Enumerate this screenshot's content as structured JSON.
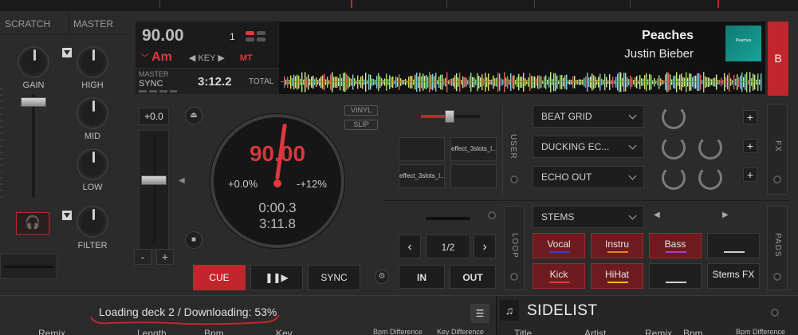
{
  "mixer": {
    "headers": [
      "SCRATCH",
      "MASTER"
    ],
    "knobs": {
      "gain": "GAIN",
      "high": "HIGH",
      "mid": "MID",
      "low": "LOW",
      "filter": "FILTER"
    },
    "headphone_icon": "headphone-icon"
  },
  "deck": {
    "bpm": "90.00",
    "deck_number": "1",
    "key": "Am",
    "key_label": "KEY",
    "mt_label": "MT",
    "master_label": "MASTER",
    "sync_label": "SYNC",
    "time_total": "3:12.2",
    "total_label": "TOTAL",
    "track_title": "Peaches",
    "track_artist": "Justin Bieber",
    "cover_text": "Peaches",
    "deck_button": "B",
    "pitch_value": "+0.0",
    "vinyl_label": "VINYL",
    "slip_label": "SLIP",
    "platter": {
      "bpm": "90.00",
      "pitch_left": "+0.0%",
      "pitch_right": "-+12%",
      "elapsed": "0:00.3",
      "remaining": "3:11.8"
    },
    "minus_label": "-",
    "plus_label": "+",
    "cue_label": "CUE",
    "play_label": "❚❚▶",
    "sync_button": "SYNC",
    "accent_color": "#c0262b"
  },
  "fx": {
    "user_label": "USER",
    "fx_label": "FX",
    "slots": [
      "effect_3slots_l...",
      "effect_3slots_l..."
    ],
    "effects": [
      "BEAT GRID",
      "DUCKING EC...",
      "ECHO OUT"
    ],
    "plus": "+"
  },
  "loop": {
    "loop_label": "LOOP",
    "size": "1/2",
    "prev": "‹",
    "next": "›",
    "in_label": "IN",
    "out_label": "OUT"
  },
  "pads": {
    "mode": "STEMS",
    "pads_label": "PADS",
    "buttons": [
      {
        "label": "Vocal",
        "color": "#3b3bd6"
      },
      {
        "label": "Instru",
        "color": "#e08a1a"
      },
      {
        "label": "Bass",
        "color": "#a040d0"
      },
      {
        "label": "",
        "color": "#d0d0d0"
      },
      {
        "label": "Kick",
        "color": "#e0383e"
      },
      {
        "label": "HiHat",
        "color": "#e0c020"
      },
      {
        "label": "",
        "color": "#d0d0d0"
      },
      {
        "label": "Stems FX",
        "color": ""
      }
    ]
  },
  "browser": {
    "status": "Loading deck 2 / Downloading: 53%",
    "columns": [
      "Remix",
      "Length",
      "Bpm",
      "Key",
      "Bpm Difference",
      "Key Difference"
    ],
    "sidelist_title": "SIDELIST",
    "sidelist_columns": [
      "Title",
      "Artist",
      "Remix",
      "Bpm",
      "Bpm Difference"
    ]
  }
}
